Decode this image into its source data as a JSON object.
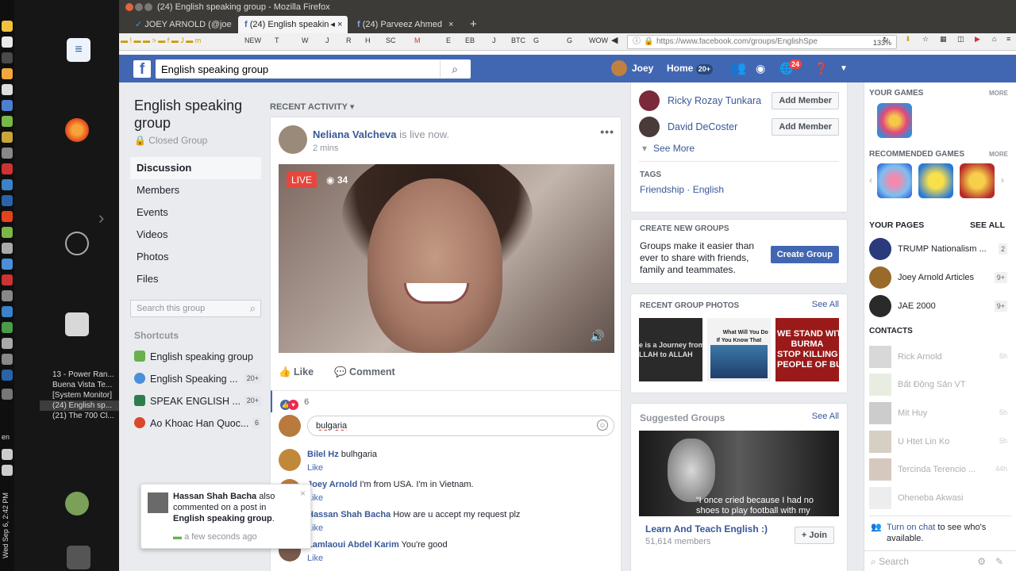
{
  "window": {
    "title": "(24) English speaking group - Mozilla Firefox"
  },
  "tabs": [
    {
      "label": "JOEY ARNOLD (@joey"
    },
    {
      "label": "(24) English speakin"
    },
    {
      "label": "(24) Parveez Ahmed"
    }
  ],
  "bookmarks": [
    "NEW",
    "T",
    "W",
    "J",
    "R",
    "H",
    "SC",
    "M",
    "E",
    "EB",
    "J",
    "BTC",
    "G",
    "G",
    "WOW",
    "m"
  ],
  "url": {
    "text": "https://www.facebook.com/groups/EnglishSpe",
    "zoom": "133%"
  },
  "desktop": {
    "task_windows": [
      "13 - Power Ran...",
      "Buena Vista Te...",
      "[System Monitor]",
      "(24) English sp...",
      "(21) The 700 Cl..."
    ],
    "clock": "Wed Sep 6, 2:42 PM",
    "lang": "en"
  },
  "fb_header": {
    "logo": "f",
    "search_value": "English speaking group",
    "user_name": "Joey",
    "home_label": "Home",
    "home_badge": "20+",
    "notif_badge": "24"
  },
  "group": {
    "name": "English speaking group",
    "privacy": "Closed Group",
    "nav": [
      "Discussion",
      "Members",
      "Events",
      "Videos",
      "Photos",
      "Files"
    ],
    "search_placeholder": "Search this group",
    "shortcuts_heading": "Shortcuts",
    "shortcuts": [
      {
        "label": "English speaking group",
        "count": ""
      },
      {
        "label": "English Speaking ...",
        "count": "20+"
      },
      {
        "label": "SPEAK ENGLISH ...",
        "count": "20+"
      },
      {
        "label": "Ao Khoac Han Quoc...",
        "count": "6"
      }
    ]
  },
  "feed": {
    "heading": "RECENT ACTIVITY",
    "post": {
      "author": "Neliana Valcheva",
      "status": "is live now.",
      "time": "2 mins",
      "live_label": "LIVE",
      "viewers": "34",
      "like_label": "Like",
      "comment_label": "Comment",
      "reaction_count": "6",
      "comment_input_value": "bulgaria",
      "comments": [
        {
          "name": "Bilel Hz",
          "text": "bulhgaria",
          "like": "Like"
        },
        {
          "name": "Joey Arnold",
          "text": "I'm from USA. I'm in Vietnam.",
          "like": "Like"
        },
        {
          "name": "Hassan Shah Bacha",
          "text": "How are u accept my request plz",
          "like": "Like"
        },
        {
          "name": "Lamlaoui Abdel Karim",
          "text": "You're good",
          "like": "Like"
        }
      ]
    }
  },
  "notification": {
    "name": "Hassan Shah Bacha",
    "middle": " also commented on a post in ",
    "group": "English speaking group",
    "end": ".",
    "time": "a few seconds ago"
  },
  "right": {
    "members": [
      {
        "name": "Ricky Rozay Tunkara",
        "button": "Add Member"
      },
      {
        "name": "David DeCoster",
        "button": "Add Member"
      }
    ],
    "see_more": "See More",
    "tags_heading": "TAGS",
    "tags": "Friendship · English",
    "create_heading": "CREATE NEW GROUPS",
    "create_text": "Groups make it easier than ever to share with friends, family and teammates.",
    "create_button": "Create Group",
    "photos_heading": "RECENT GROUP PHOTOS",
    "photos_see_all": "See All",
    "photo_captions": [
      "e is a Journey from\nLLAH to ALLAH",
      "What Will You Do\nIf You Know That",
      "WE STAND WITH\nBURMA\nSTOP KILLING INNOCENT\nPEOPLE OF BURMA"
    ],
    "suggested_heading": "Suggested Groups",
    "suggested_see_all": "See All",
    "suggested_quote": "“I once cried because I had no shoes to play football with my",
    "suggested_name": "Learn And Teach English :)",
    "suggested_members": "51,614 members",
    "join_label": "Join"
  },
  "far_right": {
    "games_heading": "YOUR GAMES",
    "more1": "MORE",
    "rec_games_heading": "RECOMMENDED GAMES",
    "more2": "MORE",
    "pages_heading": "YOUR PAGES",
    "pages_see_all": "SEE ALL",
    "pages": [
      {
        "name": "TRUMP Nationalism ...",
        "count": "2"
      },
      {
        "name": "Joey Arnold Articles",
        "count": "9+"
      },
      {
        "name": "JAE 2000",
        "count": "9+"
      }
    ],
    "contacts_heading": "CONTACTS",
    "contacts": [
      {
        "name": "Rick Arnold",
        "time": "5h"
      },
      {
        "name": "Bất Động Sản VT",
        "time": ""
      },
      {
        "name": "Mit Huy",
        "time": "5h"
      },
      {
        "name": "U Htet Lin Ko",
        "time": "5h"
      },
      {
        "name": "Tercinda Terencio ...",
        "time": "44h"
      },
      {
        "name": "Oheneba Akwasi",
        "time": ""
      }
    ],
    "chat_link": "Turn on chat",
    "chat_text": " to see who's available.",
    "search_placeholder": "Search"
  },
  "colors": {
    "fb_blue": "#4267b2",
    "link": "#385898",
    "live_red": "#e8453c"
  }
}
